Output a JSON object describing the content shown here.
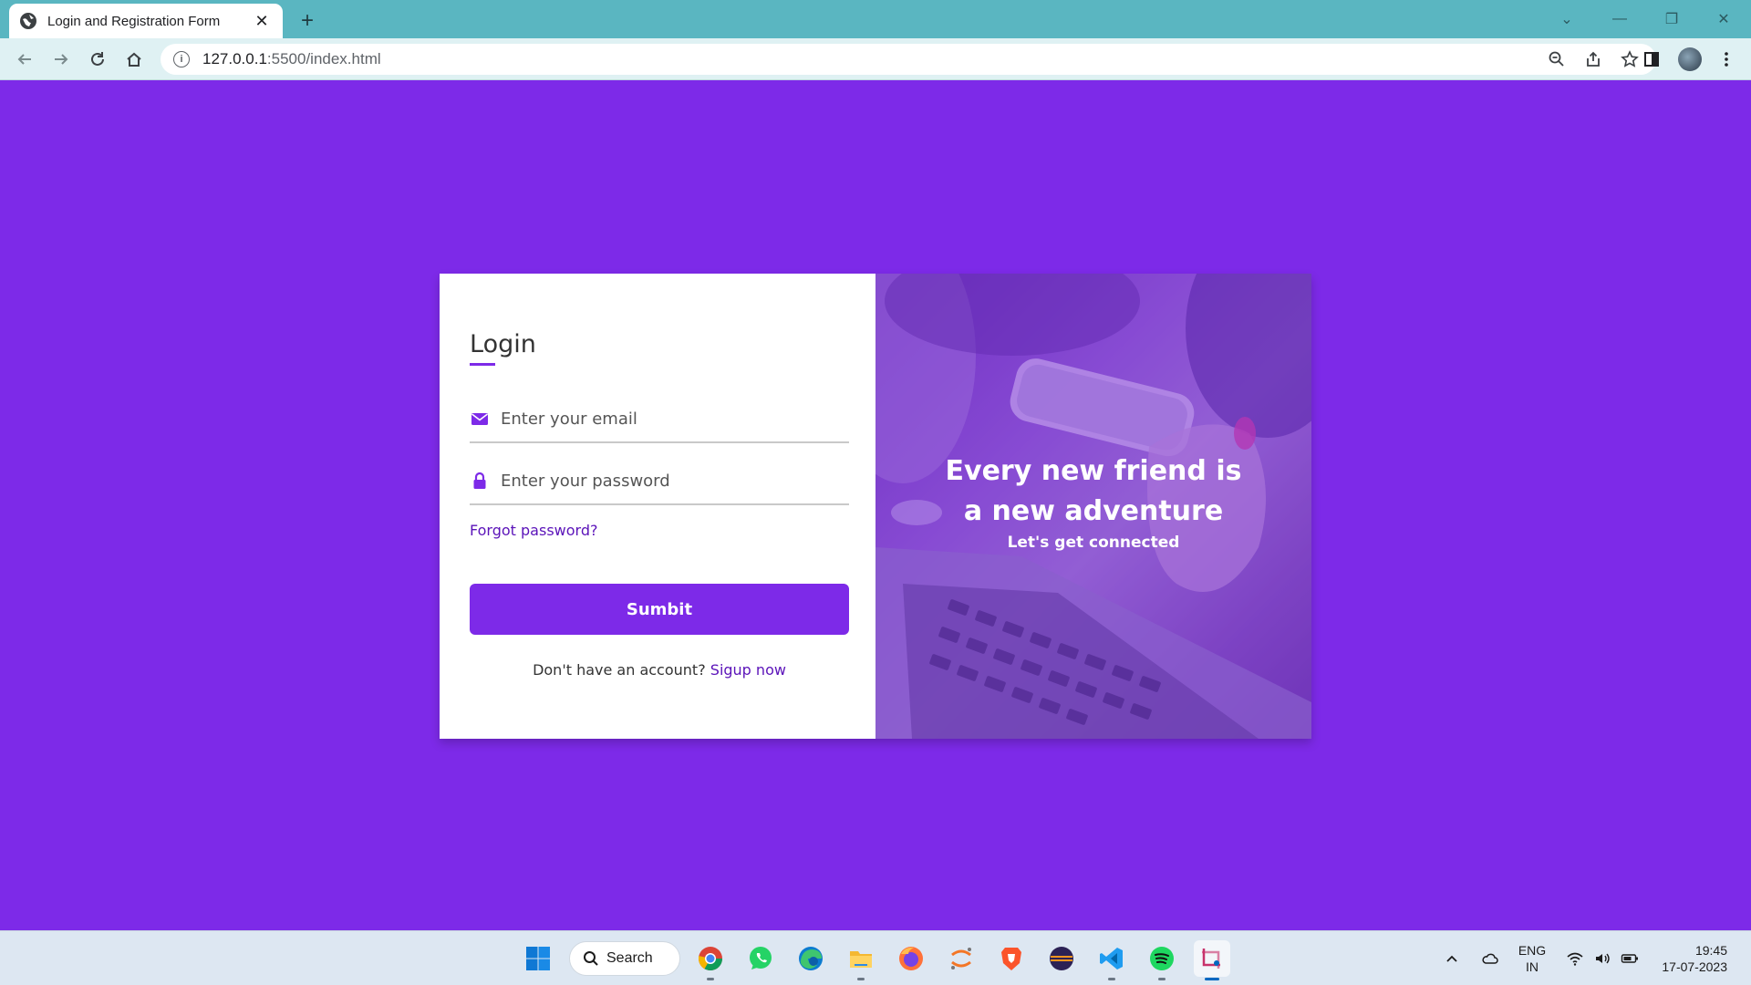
{
  "browser": {
    "tab_title": "Login and Registration Form",
    "tab_close": "✕",
    "new_tab": "+",
    "url_host": "127.0.0.1",
    "url_rest": ":5500/index.html",
    "info_glyph": "i"
  },
  "window_controls": {
    "chevron": "⌄",
    "minimize": "—",
    "restore": "❐",
    "close": "✕"
  },
  "login": {
    "title": "Login",
    "email_placeholder": "Enter your email",
    "password_placeholder": "Enter your password",
    "forgot_label": "Forgot password?",
    "submit_label": "Sumbit",
    "no_account_text": "Don't have an account?",
    "signup_label": "Sigup now"
  },
  "hero": {
    "title": "Every new friend is a new adventure",
    "subtitle": "Let's get connected"
  },
  "taskbar": {
    "search_label": "Search",
    "lang_primary": "ENG",
    "lang_secondary": "IN",
    "time": "19:45",
    "date": "17-07-2023"
  },
  "colors": {
    "page_background": "#7d2ae8",
    "accent": "#7d2ae8",
    "link": "#5b13b9",
    "tab_strip": "#5ab6c1"
  },
  "icons": {
    "email_field": "envelope-icon",
    "password_field": "lock-icon",
    "tab_favicon": "globe-icon"
  }
}
